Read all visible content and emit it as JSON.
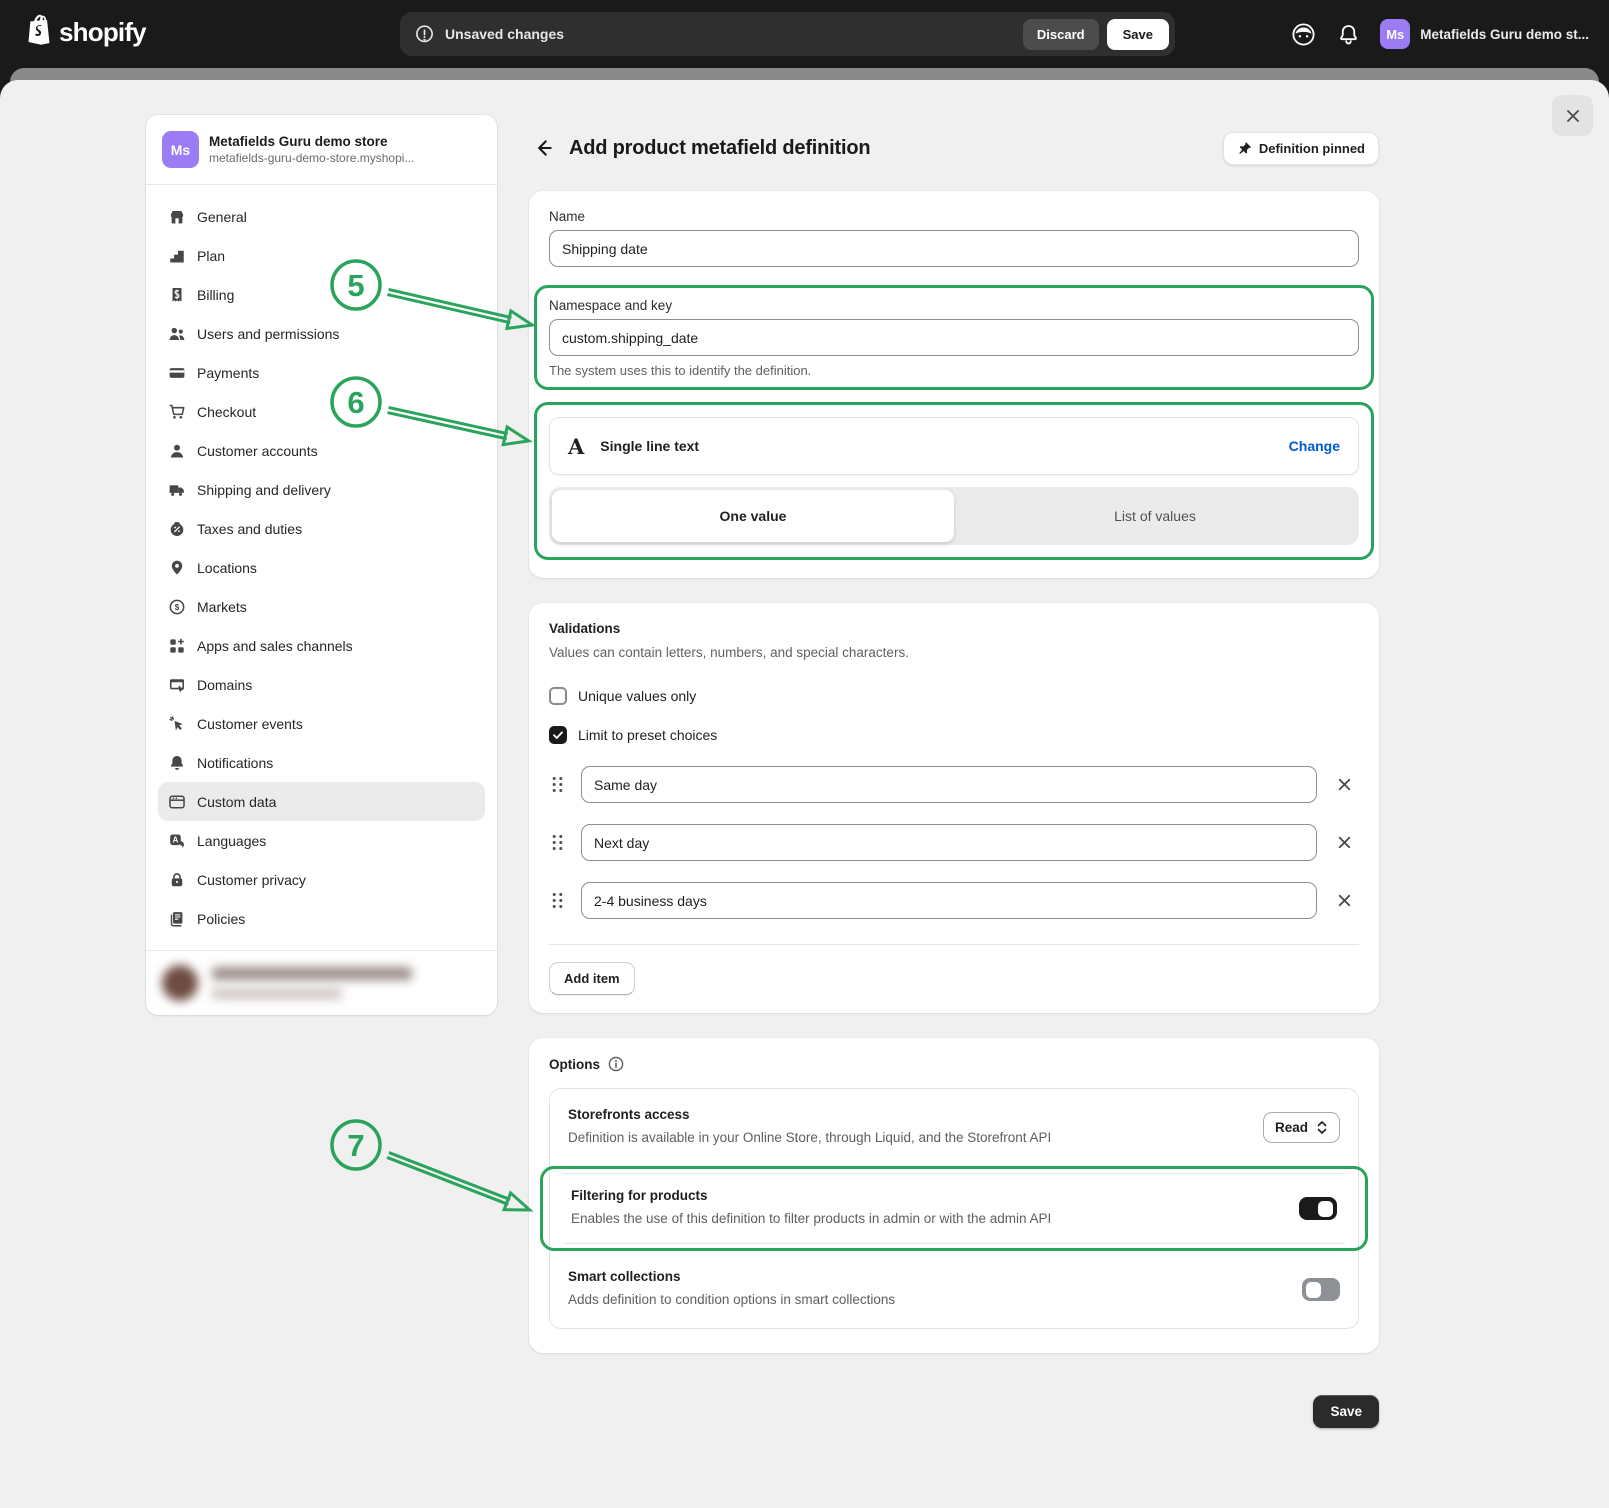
{
  "topbar": {
    "logo_word": "shopify",
    "unsaved_text": "Unsaved changes",
    "discard_label": "Discard",
    "save_label": "Save",
    "avatar_initials": "Ms",
    "store_label": "Metafields Guru demo st...",
    "avatar_color": "#9b7cf5"
  },
  "sidebar": {
    "avatar_initials": "Ms",
    "store_name": "Metafields Guru demo store",
    "store_domain": "metafields-guru-demo-store.myshopi...",
    "selected": "Custom data",
    "items": [
      {
        "label": "General",
        "icon": "storefront-icon"
      },
      {
        "label": "Plan",
        "icon": "plan-icon"
      },
      {
        "label": "Billing",
        "icon": "billing-icon"
      },
      {
        "label": "Users and permissions",
        "icon": "users-icon"
      },
      {
        "label": "Payments",
        "icon": "payments-icon"
      },
      {
        "label": "Checkout",
        "icon": "checkout-cart-icon"
      },
      {
        "label": "Customer accounts",
        "icon": "customer-accounts-icon"
      },
      {
        "label": "Shipping and delivery",
        "icon": "shipping-truck-icon"
      },
      {
        "label": "Taxes and duties",
        "icon": "taxes-icon"
      },
      {
        "label": "Locations",
        "icon": "locations-pin-icon"
      },
      {
        "label": "Markets",
        "icon": "markets-globe-icon"
      },
      {
        "label": "Apps and sales channels",
        "icon": "apps-icon"
      },
      {
        "label": "Domains",
        "icon": "domains-icon"
      },
      {
        "label": "Customer events",
        "icon": "customer-events-icon"
      },
      {
        "label": "Notifications",
        "icon": "notifications-bell-icon"
      },
      {
        "label": "Custom data",
        "icon": "custom-data-icon"
      },
      {
        "label": "Languages",
        "icon": "languages-icon"
      },
      {
        "label": "Customer privacy",
        "icon": "privacy-lock-icon"
      },
      {
        "label": "Policies",
        "icon": "policies-icon"
      }
    ]
  },
  "main": {
    "title": "Add product metafield definition",
    "pinned_button_label": "Definition pinned",
    "definition_card": {
      "name_label": "Name",
      "name_value": "Shipping date",
      "namespace_label": "Namespace and key",
      "namespace_value": "custom.shipping_date",
      "namespace_help": "The system uses this to identify the definition.",
      "type_icon": "A",
      "type_name": "Single line text",
      "change_label": "Change",
      "segments": [
        "One value",
        "List of values"
      ],
      "selected_segment": "One value"
    },
    "validations_card": {
      "title": "Validations",
      "subtitle": "Values can contain letters, numbers, and special characters.",
      "checkboxes": [
        {
          "label": "Unique values only",
          "checked": false
        },
        {
          "label": "Limit to preset choices",
          "checked": true
        }
      ],
      "choices": [
        "Same day",
        "Next day",
        "2-4 business days"
      ],
      "add_item_label": "Add item"
    },
    "options_card": {
      "title": "Options",
      "rows": [
        {
          "title": "Storefronts access",
          "description": "Definition is available in your Online Store, through Liquid, and the Storefront API",
          "control": "select",
          "value": "Read"
        },
        {
          "title": "Filtering for products",
          "description": "Enables the use of this definition to filter products in admin or with the admin API",
          "control": "toggle",
          "on": true
        },
        {
          "title": "Smart collections",
          "description": "Adds definition to condition options in smart collections",
          "control": "toggle",
          "on": false
        }
      ]
    },
    "save_label": "Save"
  },
  "annotations": {
    "color": "#2aa45c",
    "items": [
      {
        "number": "5"
      },
      {
        "number": "6"
      },
      {
        "number": "7"
      }
    ]
  }
}
